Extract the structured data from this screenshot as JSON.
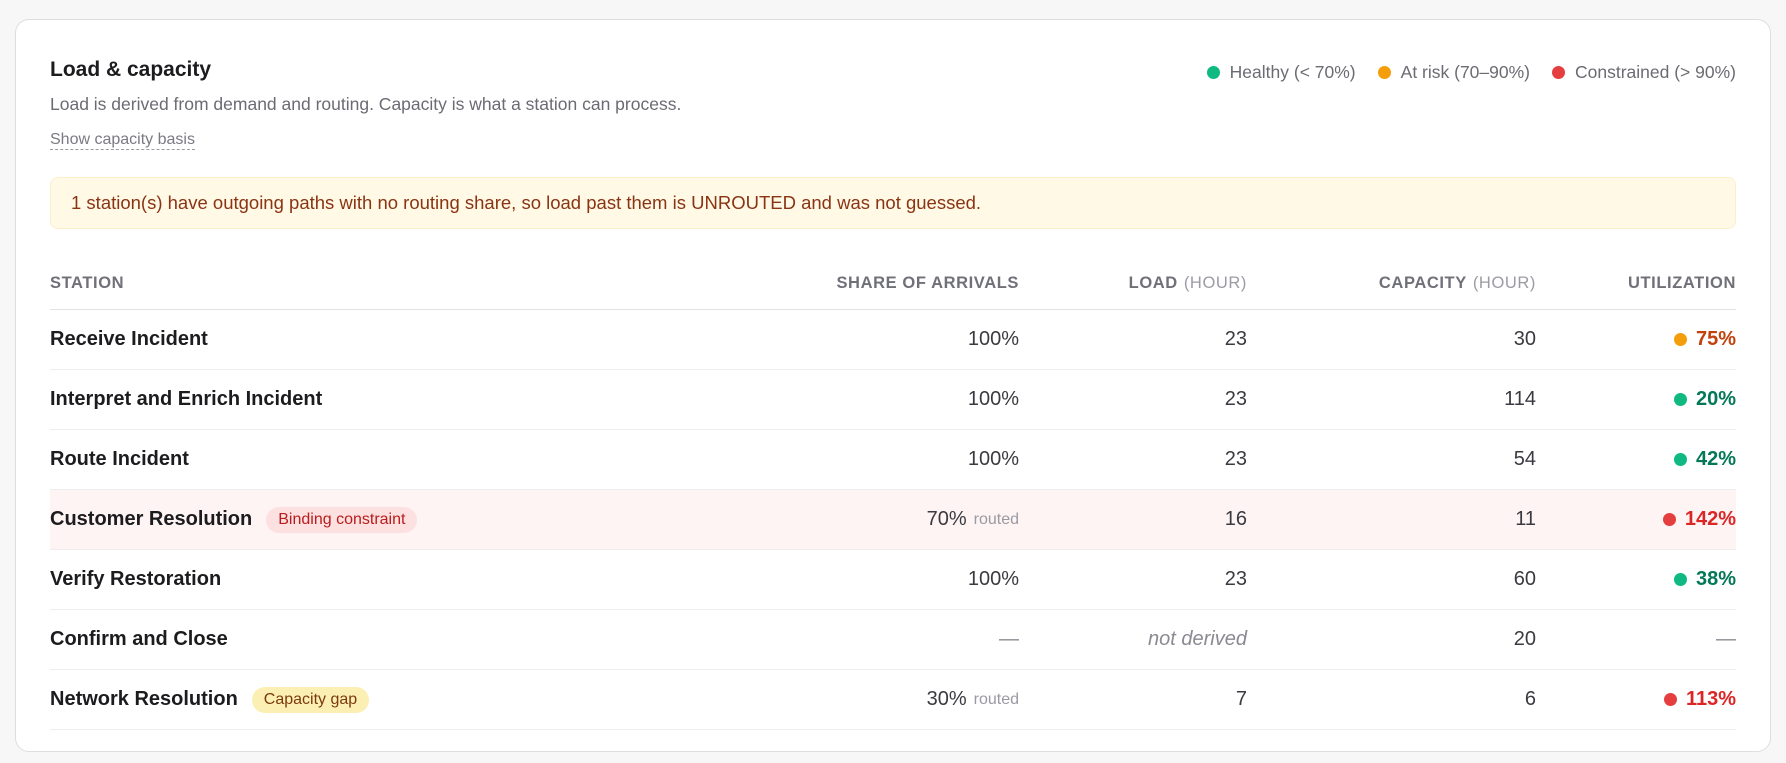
{
  "header": {
    "title": "Load & capacity",
    "subtitle": "Load is derived from demand and routing. Capacity is what a station can process.",
    "basis_link": "Show capacity basis"
  },
  "legend": [
    {
      "label": "Healthy (< 70%)",
      "color": "#10b981"
    },
    {
      "label": "At risk (70–90%)",
      "color": "#f59e0b"
    },
    {
      "label": "Constrained (> 90%)",
      "color": "#e53e3e"
    }
  ],
  "notice": "1 station(s) have outgoing paths with no routing share, so load past them is UNROUTED and was not guessed.",
  "columns": {
    "station": "STATION",
    "share": "SHARE OF ARRIVALS",
    "load": "LOAD",
    "load_unit": "(HOUR)",
    "capacity": "CAPACITY",
    "capacity_unit": "(HOUR)",
    "utilization": "UTILIZATION"
  },
  "rows": [
    {
      "station": "Receive Incident",
      "tag": "",
      "share": "100%",
      "share_note": "",
      "load": "23",
      "capacity": "30",
      "utilization": "75%",
      "status_color": "#f59e0b",
      "text_color": "#c2410c"
    },
    {
      "station": "Interpret and Enrich Incident",
      "tag": "",
      "share": "100%",
      "share_note": "",
      "load": "23",
      "capacity": "114",
      "utilization": "20%",
      "status_color": "#10b981",
      "text_color": "#047857"
    },
    {
      "station": "Route Incident",
      "tag": "",
      "share": "100%",
      "share_note": "",
      "load": "23",
      "capacity": "54",
      "utilization": "42%",
      "status_color": "#10b981",
      "text_color": "#047857"
    },
    {
      "station": "Customer Resolution",
      "tag": "Binding constraint",
      "share": "70%",
      "share_note": "routed",
      "load": "16",
      "capacity": "11",
      "utilization": "142%",
      "status_color": "#e53e3e",
      "text_color": "#dc2626"
    },
    {
      "station": "Verify Restoration",
      "tag": "",
      "share": "100%",
      "share_note": "",
      "load": "23",
      "capacity": "60",
      "utilization": "38%",
      "status_color": "#10b981",
      "text_color": "#047857"
    },
    {
      "station": "Confirm and Close",
      "tag": "",
      "share": "—",
      "share_note": "",
      "load": "not derived",
      "capacity": "20",
      "utilization": "—",
      "status_color": "",
      "text_color": "#8a8a92"
    },
    {
      "station": "Network Resolution",
      "tag": "Capacity gap",
      "share": "30%",
      "share_note": "routed",
      "load": "7",
      "capacity": "6",
      "utilization": "113%",
      "status_color": "#e53e3e",
      "text_color": "#dc2626"
    }
  ]
}
